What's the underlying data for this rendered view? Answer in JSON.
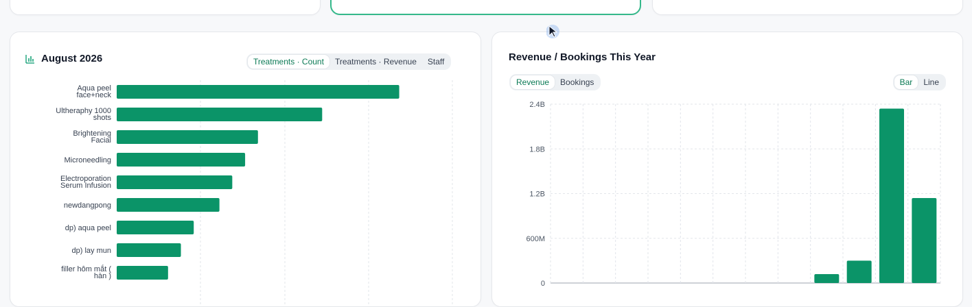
{
  "left_panel": {
    "title": "August 2026",
    "title_icon": "bar-chart-icon",
    "tabs": [
      {
        "label": "Treatments · Count",
        "active": true
      },
      {
        "label": "Treatments · Revenue",
        "active": false
      },
      {
        "label": "Staff",
        "active": false
      }
    ]
  },
  "right_panel": {
    "title": "Revenue / Bookings This Year",
    "metric_tabs": [
      {
        "label": "Revenue",
        "active": true
      },
      {
        "label": "Bookings",
        "active": false
      }
    ],
    "type_tabs": [
      {
        "label": "Bar",
        "active": true
      },
      {
        "label": "Line",
        "active": false
      }
    ]
  },
  "colors": {
    "bar": "#0b9468",
    "accent": "#0b7a55",
    "highlight_border": "#34b88a"
  },
  "chart_data": [
    {
      "type": "bar",
      "orientation": "horizontal",
      "categories": [
        [
          "Aqua peel",
          "face+neck"
        ],
        [
          "Ultheraphy 1000",
          "shots"
        ],
        [
          "Brightening",
          "Facial"
        ],
        [
          "Microneedling"
        ],
        [
          "Electroporation",
          "Serum Infusion"
        ],
        [
          "newdangpong"
        ],
        [
          "dp) aqua peel"
        ],
        [
          "dp) lay mun"
        ],
        [
          "filler hôm mắt (",
          "hàn )"
        ]
      ],
      "values": [
        22,
        16,
        11,
        10,
        9,
        8,
        6,
        5,
        4
      ],
      "xlim": [
        0,
        24
      ],
      "grid": true
    },
    {
      "type": "bar",
      "series": [
        {
          "values": [
            0,
            0,
            0,
            0,
            0,
            0,
            0,
            0,
            120000000,
            300000000,
            2340000000,
            1140000000
          ]
        }
      ],
      "yticks": [
        "0",
        "600M",
        "1.2B",
        "1.8B",
        "2.4B"
      ],
      "ylim": [
        0,
        2400000000
      ],
      "grid": true
    }
  ]
}
